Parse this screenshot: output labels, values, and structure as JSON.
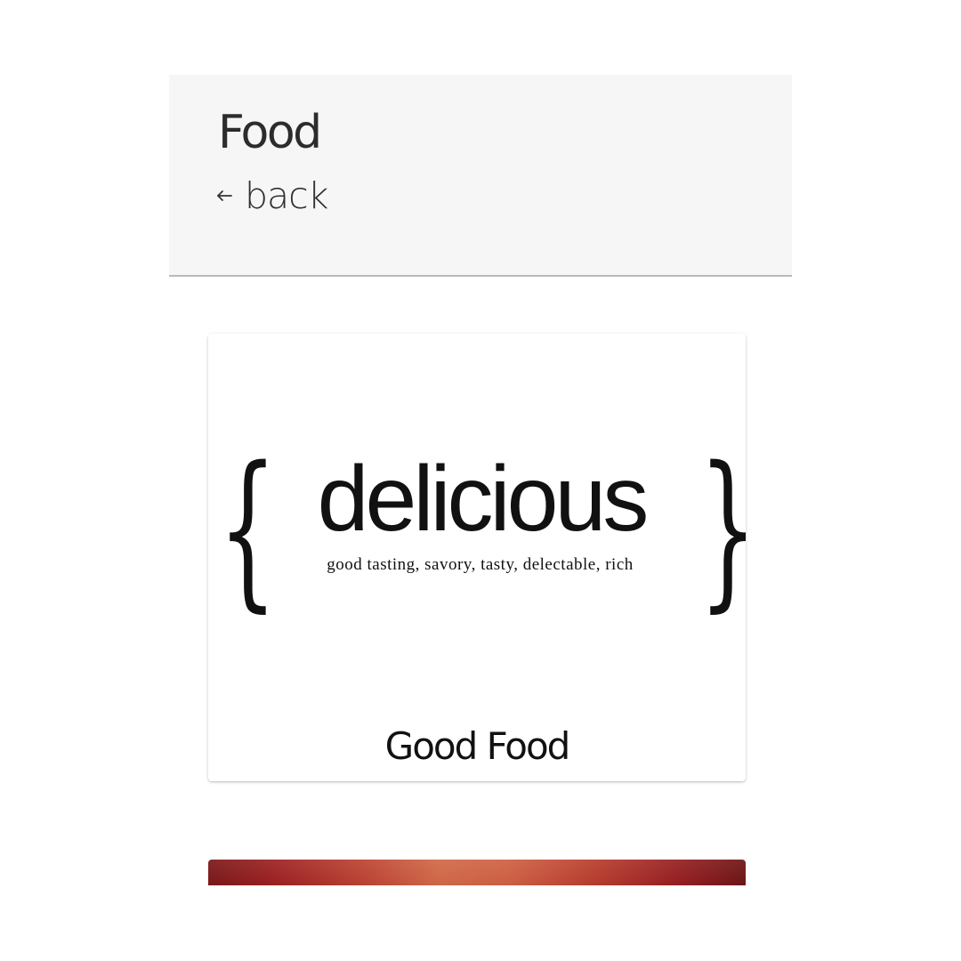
{
  "header": {
    "title": "Food",
    "back_label": "back",
    "back_icon": "arrow-left-icon"
  },
  "cards": [
    {
      "image": {
        "word": "delicious",
        "definition": "good tasting, savory, tasty, delectable, rich",
        "left_brace": "{",
        "right_brace": "}"
      },
      "title": "Good Food"
    }
  ],
  "colors": {
    "header_background": "#f6f6f6",
    "header_divider": "#b9b9b9",
    "text": "#2c2c2c",
    "next_card_accent": "#b83c2d"
  }
}
